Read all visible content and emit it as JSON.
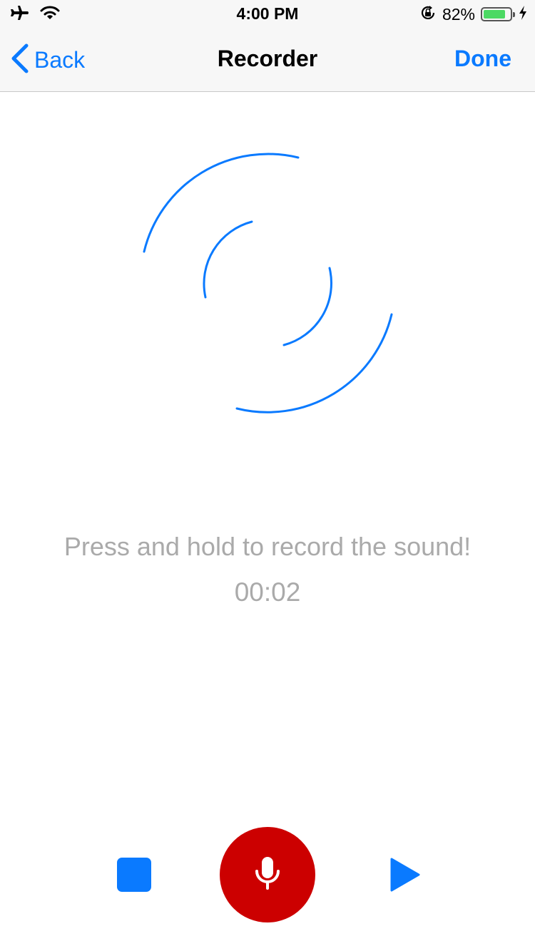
{
  "status_bar": {
    "time": "4:00 PM",
    "battery_percent": "82%",
    "battery_level": 0.82,
    "icons": [
      "airplane-icon",
      "wifi-icon",
      "rotation-lock-icon",
      "battery-icon",
      "charging-icon"
    ]
  },
  "nav": {
    "back_label": "Back",
    "title": "Recorder",
    "done_label": "Done"
  },
  "main": {
    "graphic_icon": "sound-wave-arcs-icon",
    "hint": "Press and hold to record the sound!",
    "timer": "00:02"
  },
  "controls": {
    "stop_icon": "stop-icon",
    "record_icon": "microphone-icon",
    "play_icon": "play-icon"
  },
  "colors": {
    "accent": "#0a7aff",
    "record": "#cc0000",
    "muted_text": "#aaaaaa",
    "battery_fill": "#4cd964"
  }
}
